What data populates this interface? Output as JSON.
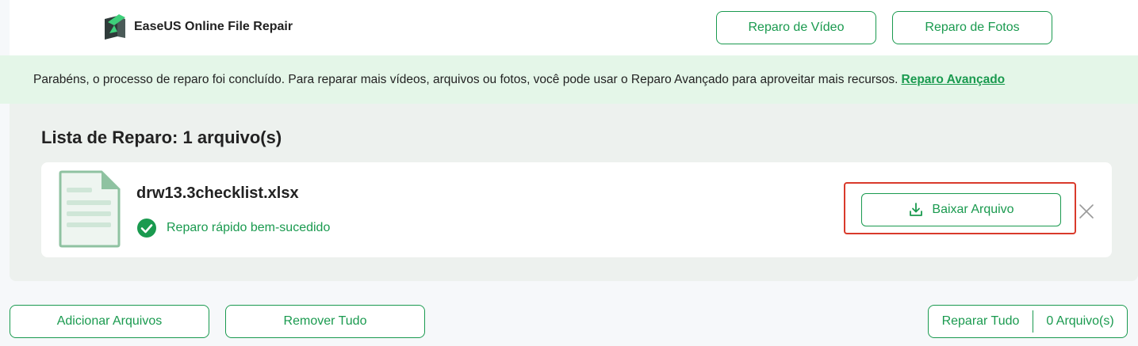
{
  "header": {
    "brand": "EaseUS Online File Repair",
    "buttons": [
      "Reparo de Vídeo",
      "Reparo de Fotos"
    ]
  },
  "banner": {
    "message": "Parabéns, o processo de reparo foi concluído. Para reparar mais vídeos, arquivos ou fotos, você pode usar o Reparo Avançado para aproveitar mais recursos.",
    "link": "Reparo Avançado"
  },
  "repair_list": {
    "title": "Lista de Reparo: 1 arquivo(s)",
    "files": [
      {
        "name": "drw13.3checklist.xlsx",
        "status": "Reparo rápido bem-sucedido",
        "action": "Baixar Arquivo"
      }
    ]
  },
  "footer": {
    "add": "Adicionar Arquivos",
    "remove": "Remover Tudo",
    "repair_all": "Reparar Tudo",
    "count": "0 Arquivo(s)"
  },
  "colors": {
    "accent": "#1a9a4f",
    "banner_bg": "#e4f6e8",
    "highlight": "#d93a2b"
  },
  "icons": [
    "logo-icon",
    "file-icon",
    "check-icon",
    "download-icon",
    "close-icon"
  ]
}
